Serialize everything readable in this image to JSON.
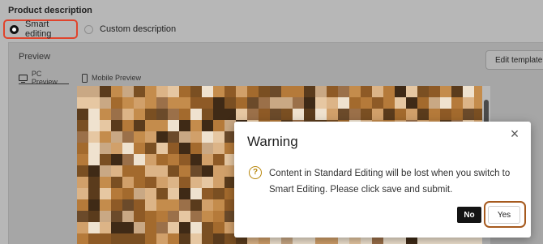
{
  "product_description": {
    "title": "Product description",
    "options": [
      {
        "label": "Smart editing",
        "selected": true
      },
      {
        "label": "Custom description",
        "selected": false
      }
    ]
  },
  "preview": {
    "label": "Preview",
    "edit_template_label": "Edit template",
    "tabs": [
      {
        "label": "PC Preview",
        "active": true
      },
      {
        "label": "Mobile Preview",
        "active": false
      }
    ]
  },
  "dialog": {
    "title": "Warning",
    "close_icon": "close-icon",
    "warning_icon": "warning-icon",
    "message": "Content in Standard Editing will be lost when you switch to Smart Editing. Please click save and submit.",
    "no_label": "No",
    "yes_label": "Yes"
  },
  "colors": {
    "highlight_smart_editing": "#e0442c",
    "highlight_yes": "#a65a1e",
    "warning_icon": "#b8860b"
  }
}
